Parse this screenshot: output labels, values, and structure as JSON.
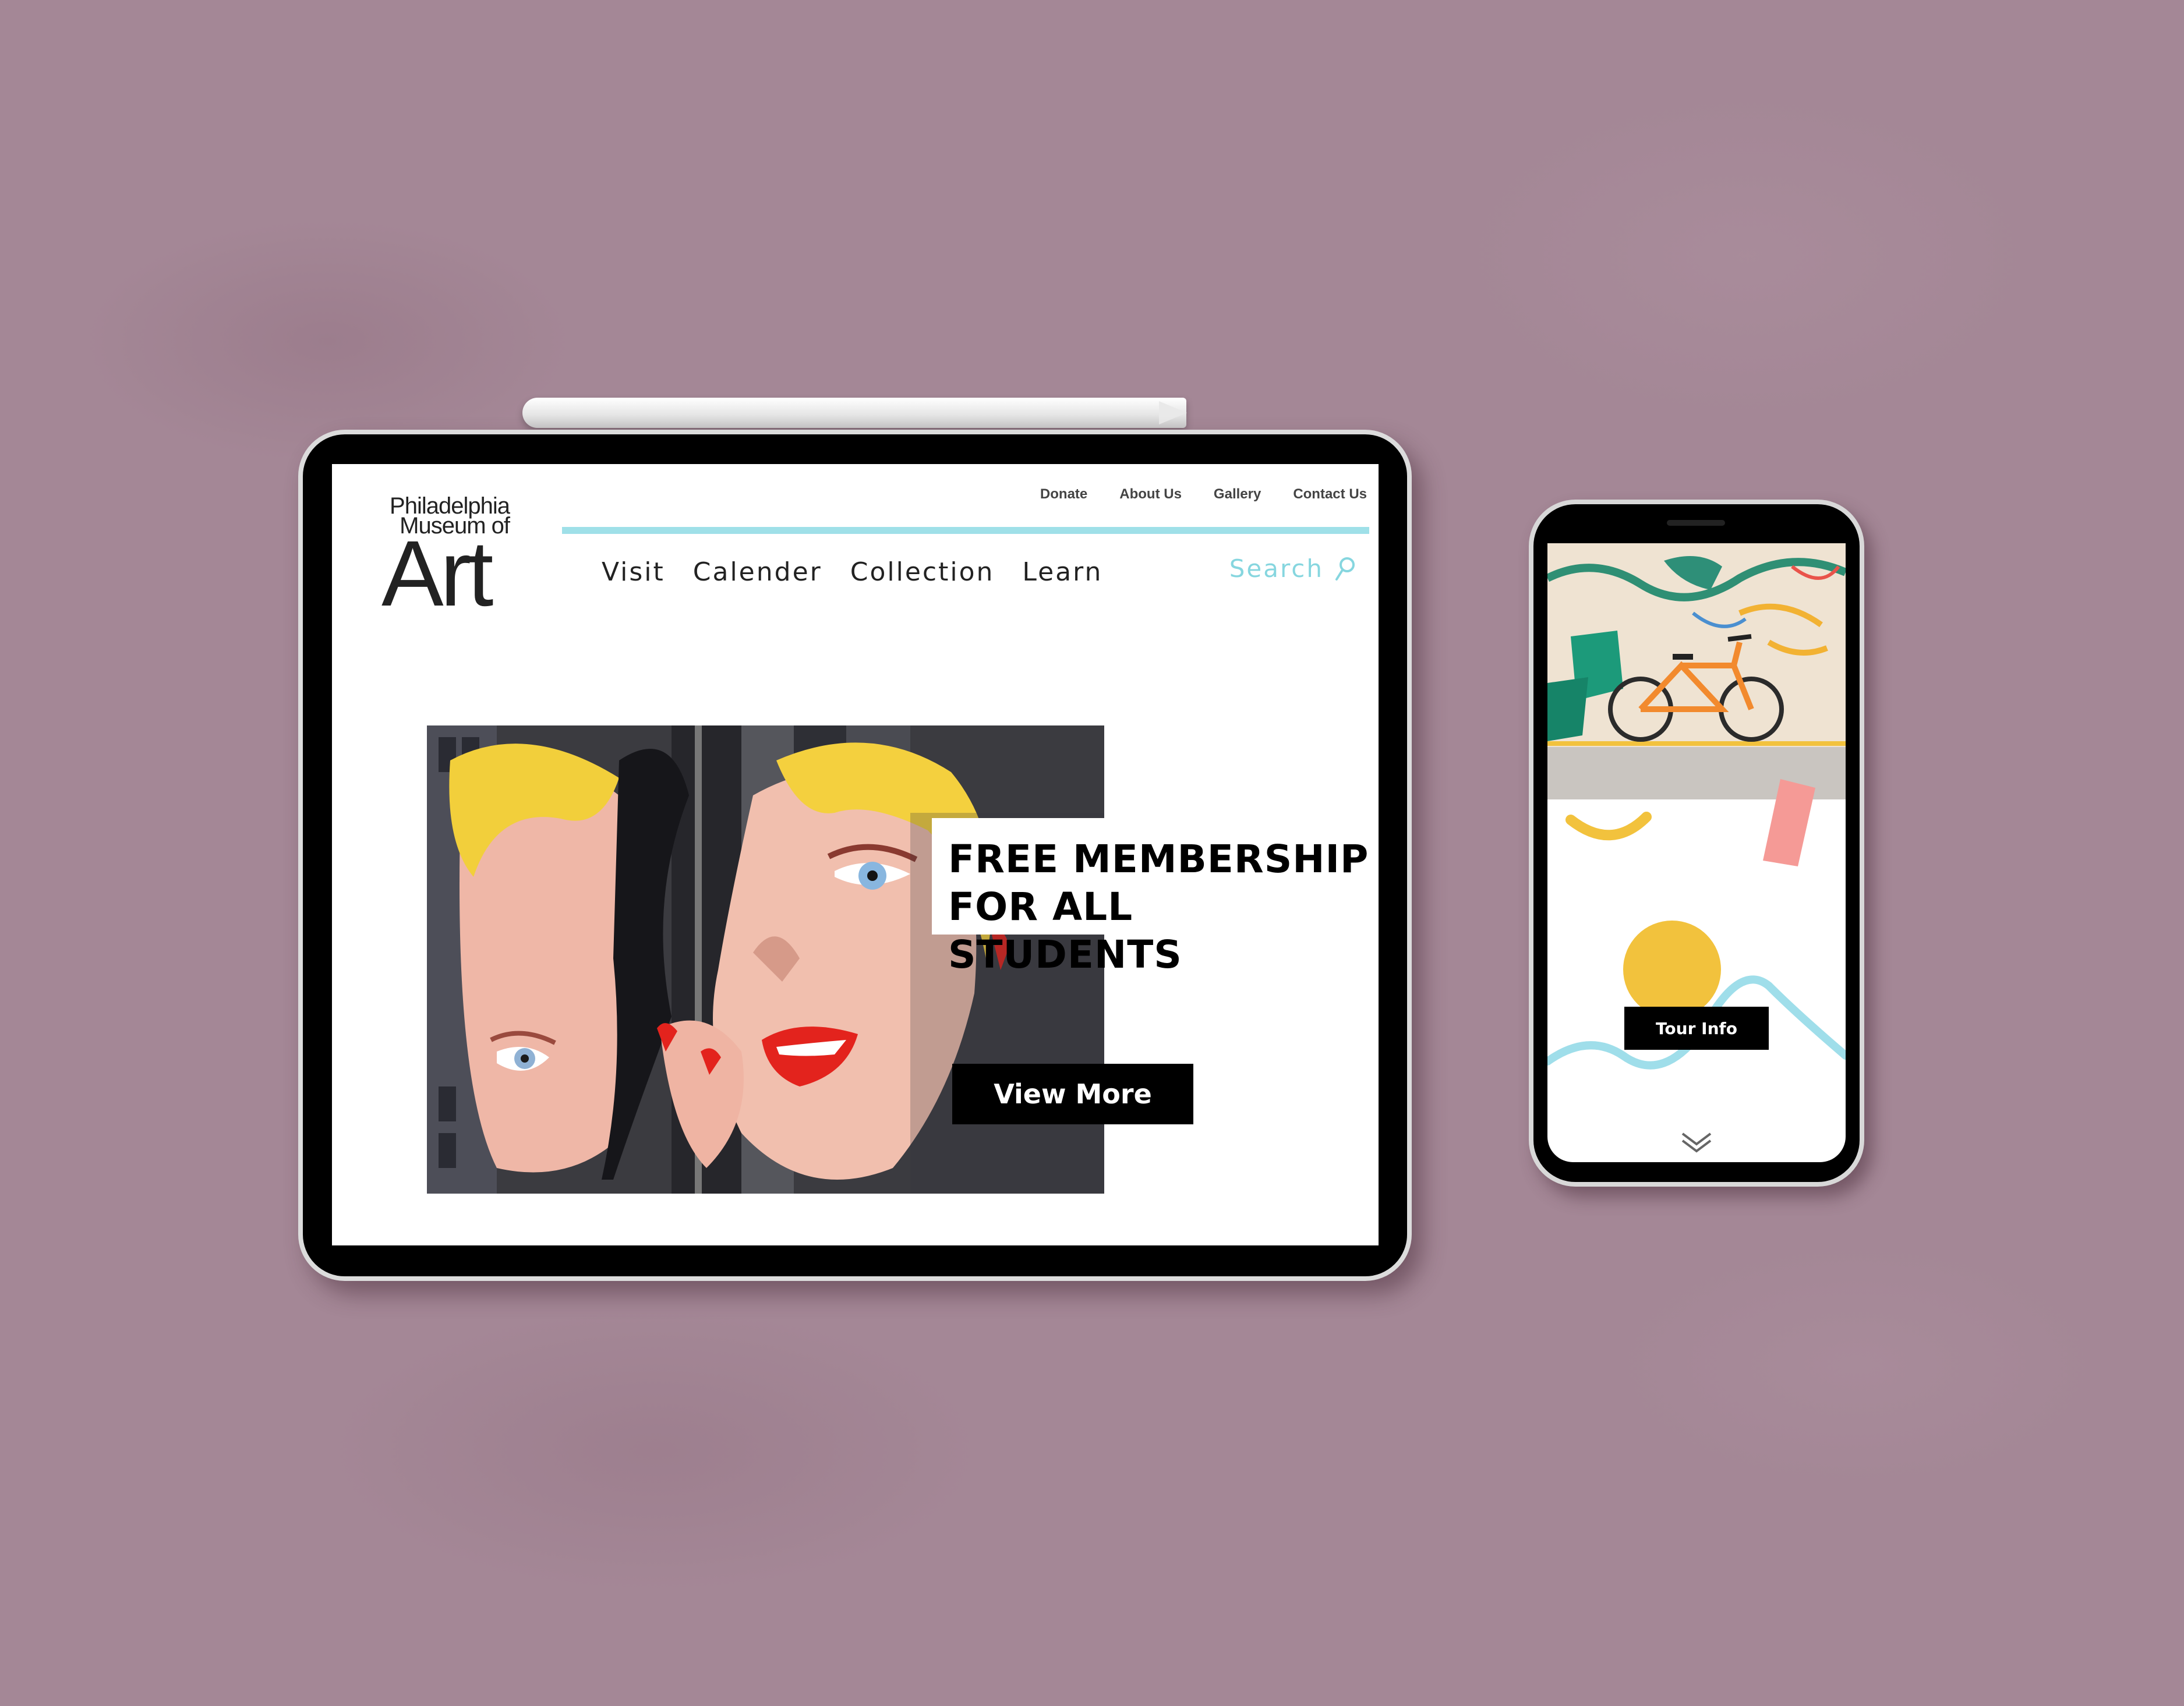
{
  "tablet": {
    "logo": {
      "line1": "Philadelphia",
      "line2": "Museum of",
      "line3": "Art"
    },
    "utility_nav": [
      "Donate",
      "About Us",
      "Gallery",
      "Contact Us"
    ],
    "main_nav": [
      "Visit",
      "Calender",
      "Collection",
      "Learn"
    ],
    "search": {
      "label": "Search",
      "icon": "search-icon"
    },
    "hero": {
      "headline_line1": "FREE MEMBERSHIP",
      "headline_line2": "FOR ALL STUDENTS",
      "cta_label": "View More"
    },
    "colors": {
      "accent_cyan": "#9fe0e8",
      "underline_pink": "#f08b8b",
      "cta_bg": "#000000"
    }
  },
  "phone": {
    "cta_label": "Tour Info",
    "scroll_icon": "chevron-down-icon",
    "colors": {
      "yellow": "#f2c23d",
      "pink": "#f59a96",
      "cyan": "#9fdeea"
    }
  },
  "background_color": "#a48796"
}
